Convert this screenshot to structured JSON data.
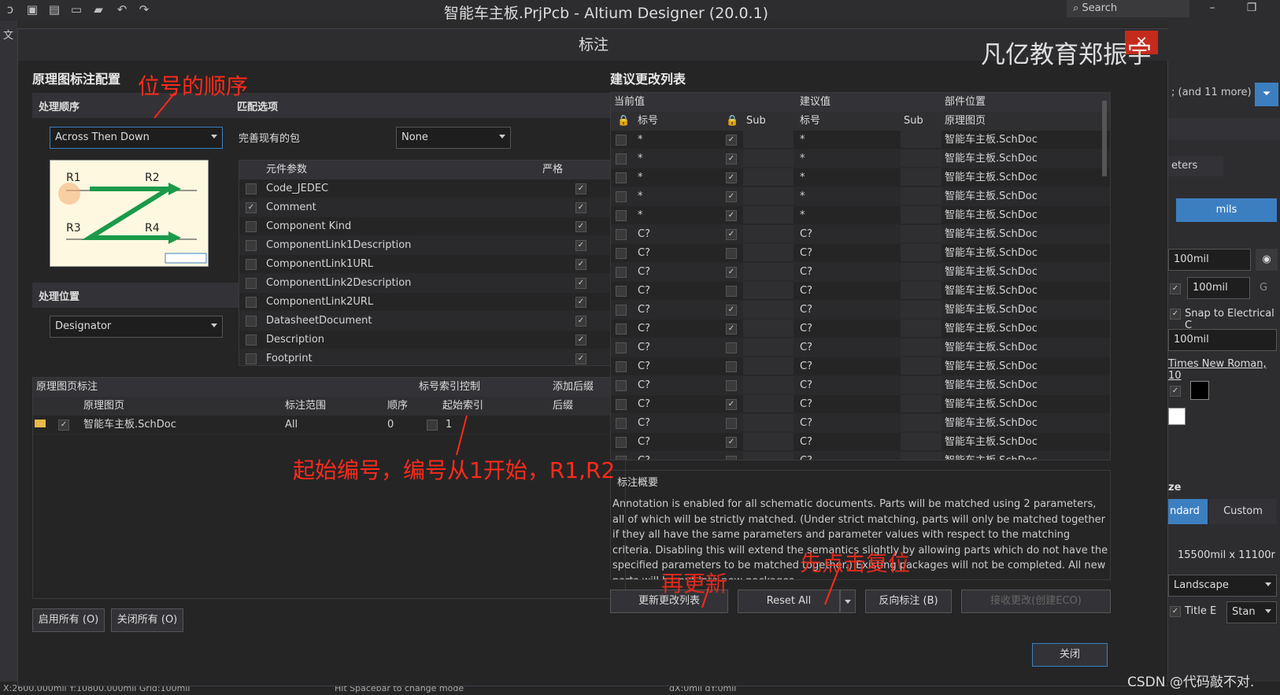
{
  "window": {
    "title": "智能车主板.PrjPcb - Altium Designer (20.0.1)",
    "search_placeholder": "Search"
  },
  "dialog": {
    "title": "标注",
    "left_heading": "原理图标注配置",
    "order_section": "处理顺序",
    "order_value": "Across Then Down",
    "order_preview_labels": [
      "R1",
      "R2",
      "R3",
      "R4"
    ],
    "location_section": "处理位置",
    "location_value": "Designator",
    "match_section": "匹配选项",
    "complete_packages_label": "完善现有的包",
    "complete_packages_value": "None",
    "params_header": {
      "param": "元件参数",
      "strict": "严格"
    },
    "params": [
      {
        "name": "Code_JEDEC",
        "checked": false,
        "strict": true
      },
      {
        "name": "Comment",
        "checked": true,
        "strict": true
      },
      {
        "name": "Component Kind",
        "checked": false,
        "strict": true
      },
      {
        "name": "ComponentLink1Description",
        "checked": false,
        "strict": true
      },
      {
        "name": "ComponentLink1URL",
        "checked": false,
        "strict": true
      },
      {
        "name": "ComponentLink2Description",
        "checked": false,
        "strict": true
      },
      {
        "name": "ComponentLink2URL",
        "checked": false,
        "strict": true
      },
      {
        "name": "DatasheetDocument",
        "checked": false,
        "strict": true
      },
      {
        "name": "Description",
        "checked": false,
        "strict": true
      },
      {
        "name": "Footprint",
        "checked": false,
        "strict": true
      }
    ],
    "sheet_table": {
      "group_headers": {
        "sheet": "原理图页标注",
        "index_ctrl": "标号索引控制",
        "suffix": "添加后缀"
      },
      "columns": {
        "sheet": "原理图页",
        "scope": "标注范围",
        "order": "顺序",
        "start": "起始索引",
        "suffix": "后缀"
      },
      "rows": [
        {
          "sheet": "智能车主板.SchDoc",
          "scope": "All",
          "order": "0",
          "start": "1",
          "suffix": ""
        }
      ]
    },
    "enable_all": "启用所有 (O)",
    "disable_all": "关闭所有 (O)",
    "changes_heading": "建议更改列表",
    "changes_group": {
      "current": "当前值",
      "proposed": "建议值",
      "location": "部件位置"
    },
    "changes_columns": {
      "designator": "标号",
      "sub": "Sub",
      "designator2": "标号",
      "sub2": "Sub",
      "sheet": "原理图页"
    },
    "changes_rows": [
      {
        "cur": "*",
        "lock": true,
        "new": "*",
        "sheet": "智能车主板.SchDoc"
      },
      {
        "cur": "*",
        "lock": true,
        "new": "*",
        "sheet": "智能车主板.SchDoc"
      },
      {
        "cur": "*",
        "lock": true,
        "new": "*",
        "sheet": "智能车主板.SchDoc"
      },
      {
        "cur": "*",
        "lock": true,
        "new": "*",
        "sheet": "智能车主板.SchDoc"
      },
      {
        "cur": "*",
        "lock": true,
        "new": "*",
        "sheet": "智能车主板.SchDoc"
      },
      {
        "cur": "C?",
        "lock": true,
        "new": "C?",
        "sheet": "智能车主板.SchDoc"
      },
      {
        "cur": "C?",
        "lock": false,
        "new": "C?",
        "sheet": "智能车主板.SchDoc"
      },
      {
        "cur": "C?",
        "lock": true,
        "new": "C?",
        "sheet": "智能车主板.SchDoc"
      },
      {
        "cur": "C?",
        "lock": false,
        "new": "C?",
        "sheet": "智能车主板.SchDoc"
      },
      {
        "cur": "C?",
        "lock": true,
        "new": "C?",
        "sheet": "智能车主板.SchDoc"
      },
      {
        "cur": "C?",
        "lock": true,
        "new": "C?",
        "sheet": "智能车主板.SchDoc"
      },
      {
        "cur": "C?",
        "lock": false,
        "new": "C?",
        "sheet": "智能车主板.SchDoc"
      },
      {
        "cur": "C?",
        "lock": false,
        "new": "C?",
        "sheet": "智能车主板.SchDoc"
      },
      {
        "cur": "C?",
        "lock": false,
        "new": "C?",
        "sheet": "智能车主板.SchDoc"
      },
      {
        "cur": "C?",
        "lock": true,
        "new": "C?",
        "sheet": "智能车主板.SchDoc"
      },
      {
        "cur": "C?",
        "lock": false,
        "new": "C?",
        "sheet": "智能车主板.SchDoc"
      },
      {
        "cur": "C?",
        "lock": true,
        "new": "C?",
        "sheet": "智能车主板.SchDoc"
      },
      {
        "cur": "C?",
        "lock": false,
        "new": "C?",
        "sheet": "智能车主板.SchDoc"
      }
    ],
    "summary_heading": "标注概要",
    "summary_text": "Annotation is enabled for all schematic documents. Parts will be matched using 2 parameters, all of which will be strictly matched. (Under strict matching, parts will only be matched together if they all have the same parameters and parameter values with respect to the matching criteria. Disabling this will extend the semantics slightly by allowing parts which do not have the specified parameters to be matched together.) Existing packages will not be completed. All new parts will be put into new packages.",
    "update_btn": "更新更改列表",
    "reset_btn": "Reset All",
    "back_annotate_btn": "反向标注 (B)",
    "accept_btn": "接收更改(创建ECO)",
    "close_btn": "关闭"
  },
  "annotations": {
    "order_note": "位号的顺序",
    "start_note": "起始编号，编号从1开始，R1,R2",
    "reset_note": "先点击复位",
    "update_note": "再更新",
    "watermark_top": "凡亿教育郑振宇",
    "watermark_bottom": "CSDN @代码敲不对."
  },
  "right_panel": {
    "filter_text": "; (and 11 more)",
    "tab_text": "eters",
    "units": "mils",
    "grid1": "100mil",
    "grid2": "100mil",
    "grid2_suffix": "G",
    "snap": "Snap to Electrical C",
    "grid3": "100mil",
    "font": "Times New Roman, 10",
    "size_label": "ze",
    "standard": "ndard",
    "custom": "Custom",
    "sheet_size": "15500mil x 11100r",
    "orientation": "Landscape",
    "title_block": "Title E",
    "standard2": "Stan"
  },
  "statusbar": {
    "coords": "X:2600.000mil Y:10800.000mil   Grid:100mil",
    "hint": "Hit Spacebar to change mode",
    "delta": "dX:0mil dY:0mil"
  }
}
